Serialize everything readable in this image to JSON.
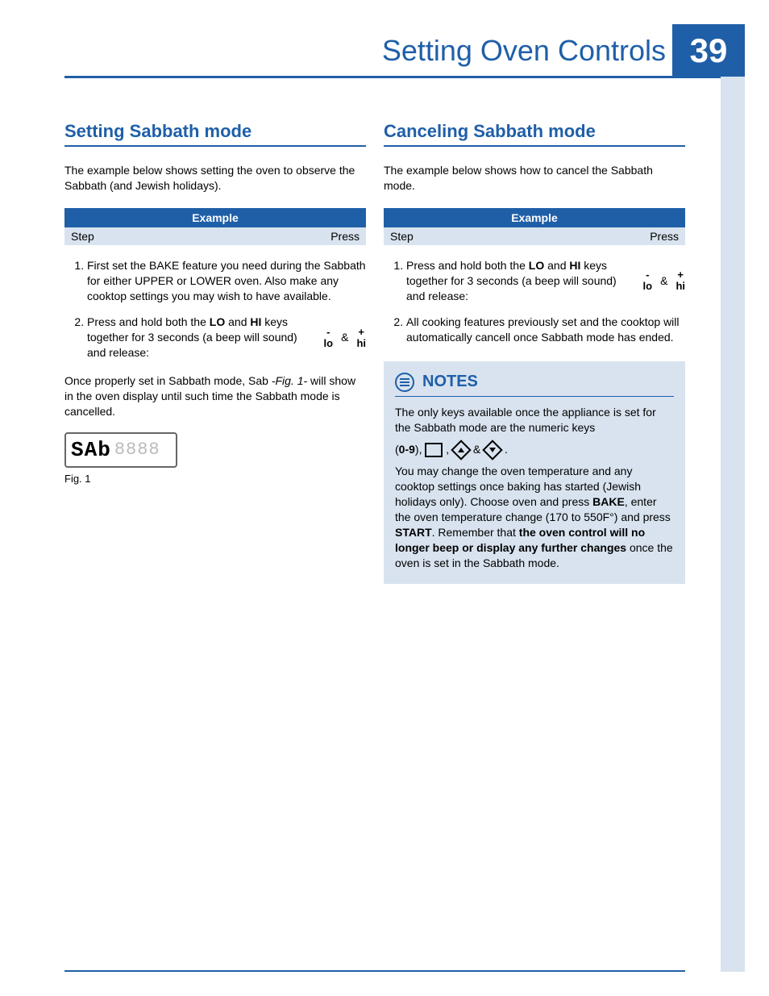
{
  "header": {
    "title": "Setting Oven Controls",
    "page_number": "39"
  },
  "left": {
    "heading": "Setting Sabbath mode",
    "intro": "The example below shows setting the oven to observe the Sabbath (and Jewish holidays).",
    "table": {
      "title": "Example",
      "col1": "Step",
      "col2": "Press"
    },
    "steps": {
      "s1": "First set the BAKE feature you need during the Sabbath for either UPPER or LOWER oven. Also make any cooktop settings you may wish to have available.",
      "s2_pre": "Press and hold both the ",
      "s2_lo": "LO",
      "s2_mid": " and ",
      "s2_hi": "HI",
      "s2_post": " keys together for 3 seconds (a beep will sound) and release:"
    },
    "keys": {
      "lo_sign": "-",
      "lo_label": "lo",
      "amp": "&",
      "hi_sign": "+",
      "hi_label": "hi"
    },
    "after_pre": "Once properly set in Sabbath mode, Sab ",
    "after_fig": "-Fig. 1-",
    "after_post": " will show in the oven display until such time the Sabbath mode is cancelled.",
    "display_active": "SAb",
    "display_dim": "8888",
    "fig_label": "Fig. 1"
  },
  "right": {
    "heading": "Canceling Sabbath mode",
    "intro": "The example below shows how to cancel the Sabbath mode.",
    "table": {
      "title": "Example",
      "col1": "Step",
      "col2": "Press"
    },
    "steps": {
      "s1_pre": "Press and hold both the ",
      "s1_lo": "LO",
      "s1_mid": " and ",
      "s1_hi": "HI",
      "s1_post": " keys together for 3 seconds (a beep will sound) and release:",
      "s2": "All cooking features previously set and the cooktop will automatically cancell once Sabbath mode has ended."
    },
    "keys": {
      "lo_sign": "-",
      "lo_label": "lo",
      "amp": "&",
      "hi_sign": "+",
      "hi_label": "hi"
    }
  },
  "notes": {
    "title": "NOTES",
    "p1": "The only keys available once the appliance is set for the Sabbath mode are the numeric keys",
    "keys_pre": "(",
    "keys_bold": "0-9",
    "keys_mid1": "), ",
    "keys_comma": " , ",
    "keys_amp": " & ",
    "keys_end": " .",
    "p2_a": "You may change the oven temperature and any cooktop settings once baking has started (Jewish holidays only). Choose oven and press ",
    "p2_bake": "BAKE",
    "p2_b": ", enter the oven temperature change (170 to 550F°) and press ",
    "p2_start": "START",
    "p2_c": ". Remember that ",
    "p2_bold": "the oven control will no longer beep or display any further changes",
    "p2_d": " once the oven is set in the Sabbath mode."
  }
}
